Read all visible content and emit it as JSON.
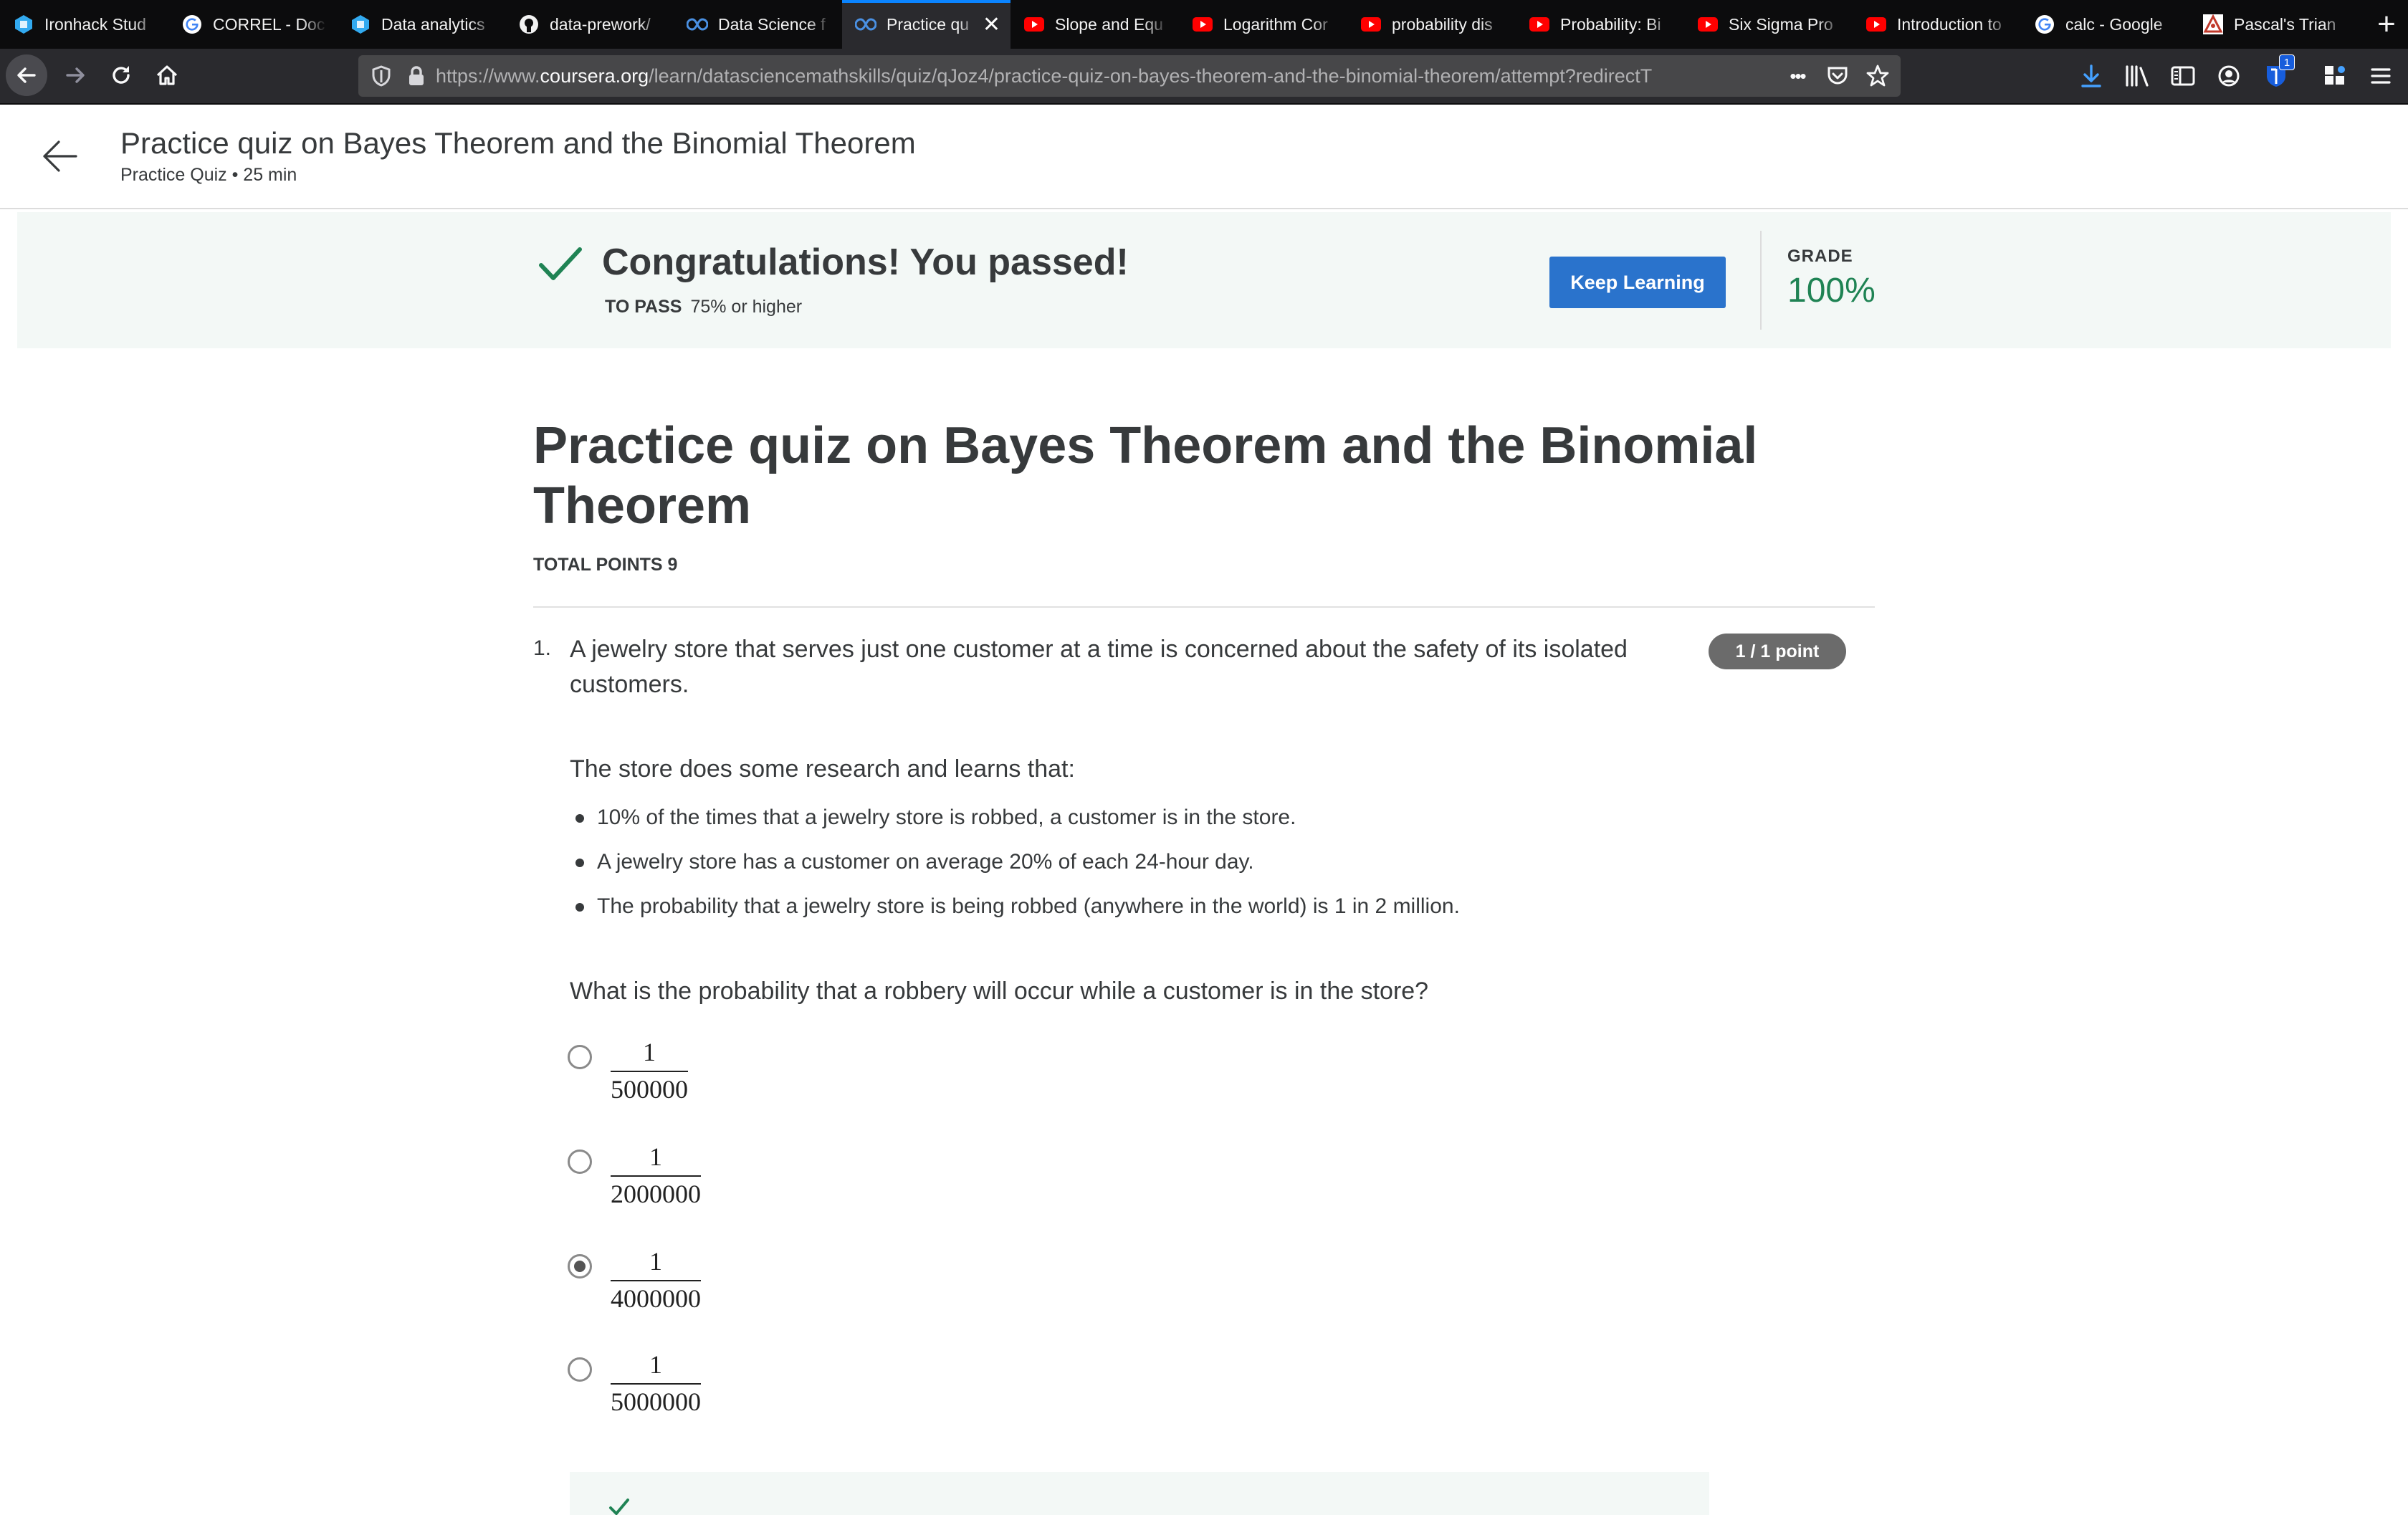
{
  "browser": {
    "tabs": [
      {
        "label": "Ironhack Stud",
        "icon": "ironhack-icon",
        "active": false
      },
      {
        "label": "CORREL - Doc",
        "icon": "google-icon",
        "active": false
      },
      {
        "label": "Data analytics",
        "icon": "ironhack-icon",
        "active": false
      },
      {
        "label": "data-prework/",
        "icon": "github-icon",
        "active": false
      },
      {
        "label": "Data Science f",
        "icon": "coursera-icon",
        "active": false
      },
      {
        "label": "Practice qu",
        "icon": "coursera-icon",
        "active": true
      },
      {
        "label": "Slope and Equ",
        "icon": "youtube-icon",
        "active": false
      },
      {
        "label": "Logarithm Cor",
        "icon": "youtube-icon",
        "active": false
      },
      {
        "label": "probability dis",
        "icon": "youtube-icon",
        "active": false
      },
      {
        "label": "Probability: Bi",
        "icon": "youtube-icon",
        "active": false
      },
      {
        "label": "Six Sigma Pro",
        "icon": "youtube-icon",
        "active": false
      },
      {
        "label": "Introduction to",
        "icon": "youtube-icon",
        "active": false
      },
      {
        "label": "calc - Google",
        "icon": "google-icon",
        "active": false
      },
      {
        "label": "Pascal's Trian",
        "icon": "pascal-icon",
        "active": false
      }
    ],
    "close_glyph": "✕",
    "new_tab_glyph": "+",
    "url_prefix": "https://www.",
    "url_domain": "coursera.org",
    "url_path": "/learn/datasciencemathskills/quiz/qJoz4/practice-quiz-on-bayes-theorem-and-the-binomial-theorem/attempt?redirectT",
    "more_glyph": "•••",
    "extension_badge": "1",
    "colors": {
      "tabbar": "#0c0c0d",
      "toolbar": "#2a2a2e",
      "urlbar": "#474749",
      "accent": "#0a84ff"
    }
  },
  "header": {
    "title": "Practice quiz on Bayes Theorem and the Binomial Theorem",
    "subtitle": "Practice Quiz • 25 min"
  },
  "banner": {
    "message": "Congratulations! You passed!",
    "to_pass_label": "TO PASS",
    "to_pass_value": "75% or higher",
    "keep_learning": "Keep Learning",
    "grade_label": "GRADE",
    "grade_value": "100%",
    "colors": {
      "background": "#f3f8f6",
      "success": "#1f8354",
      "button": "#2a73cc"
    }
  },
  "quiz": {
    "title": "Practice quiz on Bayes Theorem and the Binomial Theorem",
    "total_points": "TOTAL POINTS 9",
    "question": {
      "number": "1.",
      "text": "A jewelry store that serves just one customer at a time is concerned about the safety of its isolated customers.",
      "points": "1 / 1 point",
      "research_intro": "The store does some research and learns that:",
      "facts": [
        "10% of the times that a jewelry store is robbed, a customer is in the store.",
        "A jewelry store has a customer on average 20% of each 24-hour day.",
        "The probability that a jewelry store is being robbed (anywhere in the world) is 1 in 2 million."
      ],
      "prompt": "What is the probability that a robbery will occur while a customer is in the store?",
      "options": [
        {
          "numerator": "1",
          "denominator": "500000",
          "selected": false
        },
        {
          "numerator": "1",
          "denominator": "2000000",
          "selected": false
        },
        {
          "numerator": "1",
          "denominator": "4000000",
          "selected": true
        },
        {
          "numerator": "1",
          "denominator": "5000000",
          "selected": false
        }
      ]
    }
  }
}
